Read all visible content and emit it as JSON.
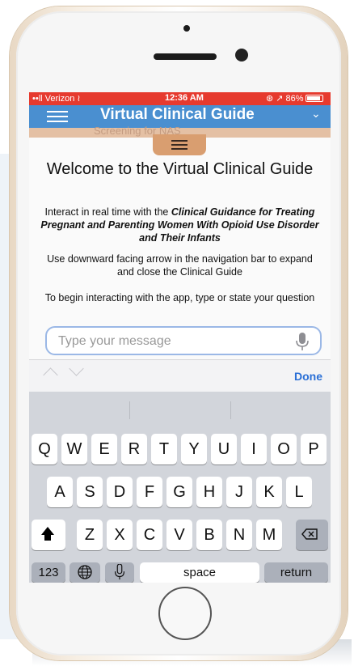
{
  "status_bar": {
    "carrier": "••ll Verizon ≀",
    "time": "12:36 AM",
    "right": "⊛ ↗ 86%"
  },
  "nav": {
    "title": "Virtual Clinical Guide",
    "subtitle_peek": "Screening for NAS"
  },
  "content": {
    "welcome": "Welcome to the Virtual Clinical Guide",
    "intro_prefix": "Interact in real time with the ",
    "intro_bold": "Clinical Guidance for Treating Pregnant and Parenting Women With Opioid Use Disorder and Their Infants",
    "instructions": "Use downward facing arrow in the navigation bar to expand and close the Clinical Guide",
    "begin": "To begin interacting with the app, type or state your question"
  },
  "message_input": {
    "placeholder": "Type your message",
    "value": ""
  },
  "keyboard_toolbar": {
    "done": "Done"
  },
  "keyboard": {
    "row1": [
      "Q",
      "W",
      "E",
      "R",
      "T",
      "Y",
      "U",
      "I",
      "O",
      "P"
    ],
    "row2": [
      "A",
      "S",
      "D",
      "F",
      "G",
      "H",
      "J",
      "K",
      "L"
    ],
    "row3": [
      "Z",
      "X",
      "C",
      "V",
      "B",
      "N",
      "M"
    ],
    "numbers_key": "123",
    "space_key": "space",
    "return_key": "return"
  }
}
